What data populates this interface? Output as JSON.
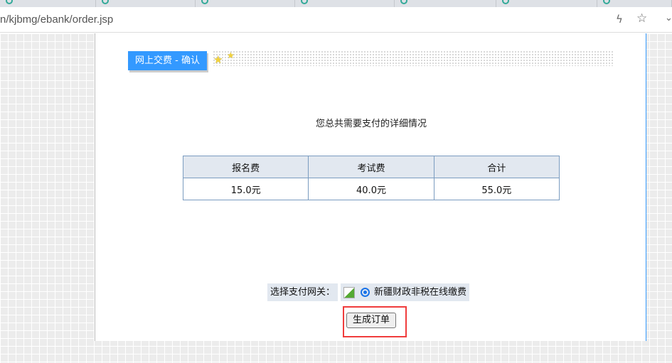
{
  "browser": {
    "url": "n/kjbmg/ebank/order.jsp",
    "tab_count": 8
  },
  "header": {
    "title": "网上交费 - 确认"
  },
  "summary": {
    "title": "您总共需要支付的详细情况"
  },
  "table": {
    "headers": [
      "报名费",
      "考试费",
      "合计"
    ],
    "rows": [
      [
        "15.0元",
        "40.0元",
        "55.0元"
      ]
    ]
  },
  "gateway": {
    "label": "选择支付网关：",
    "option": "新疆财政非税在线缴费",
    "selected": true
  },
  "actions": {
    "submit": "生成订单"
  },
  "colors": {
    "accent": "#3399ff",
    "highlight": "#f03c3c"
  }
}
